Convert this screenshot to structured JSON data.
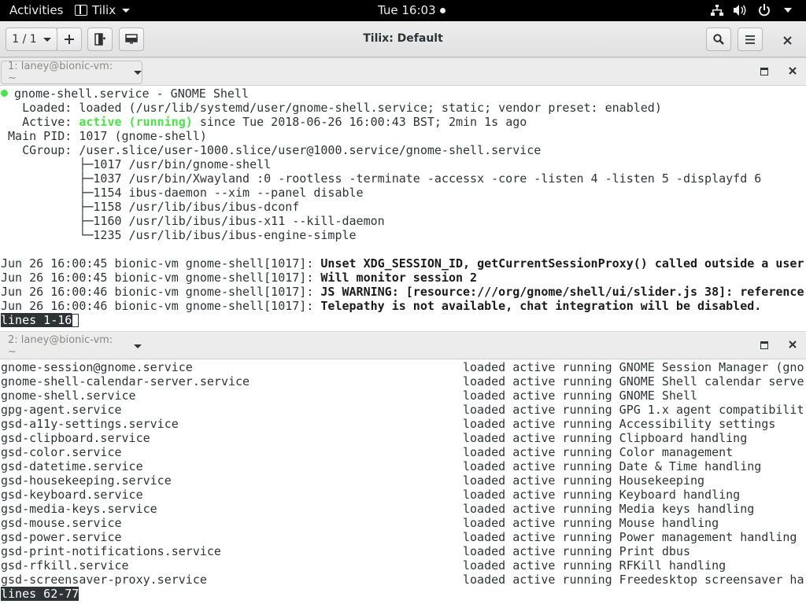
{
  "topbar": {
    "activities": "Activities",
    "app_name": "Tilix",
    "clock": "Tue 16:03",
    "icons": [
      "network-icon",
      "volume-icon",
      "power-icon",
      "chevron-down-icon"
    ]
  },
  "header": {
    "session_label": "1 / 1",
    "title": "Tilix: Default",
    "buttons": [
      "add-icon",
      "split-right-icon",
      "split-down-icon",
      "search-icon",
      "hamburger-menu-icon",
      "close-icon"
    ]
  },
  "pane1": {
    "title": "1: laney@bionic-vm: ~",
    "lines": {
      "l1": "gnome-shell.service - GNOME Shell",
      "l2": "   Loaded: loaded (/usr/lib/systemd/user/gnome-shell.service; static; vendor preset: enabled)",
      "l3a": "   Active: ",
      "l3b": "active (running)",
      "l3c": " since Tue 2018-06-26 16:00:43 BST; 2min 1s ago",
      "l4": " Main PID: 1017 (gnome-shell)",
      "l5": "   CGroup: /user.slice/user-1000.slice/user@1000.service/gnome-shell.service",
      "l6": "           ├─1017 /usr/bin/gnome-shell",
      "l7": "           ├─1037 /usr/bin/Xwayland :0 -rootless -terminate -accessx -core -listen 4 -listen 5 -displayfd 6",
      "l8": "           ├─1154 ibus-daemon --xim --panel disable",
      "l9": "           ├─1158 /usr/lib/ibus/ibus-dconf",
      "l10": "           ├─1160 /usr/lib/ibus/ibus-x11 --kill-daemon",
      "l11": "           └─1235 /usr/lib/ibus/ibus-engine-simple",
      "log": [
        {
          "prefix": "Jun 26 16:00:45 bionic-vm gnome-shell[1017]: ",
          "msg": "Unset XDG_SESSION_ID, getCurrentSessionProxy() called outside a user"
        },
        {
          "prefix": "Jun 26 16:00:45 bionic-vm gnome-shell[1017]: ",
          "msg": "Will monitor session 2"
        },
        {
          "prefix": "Jun 26 16:00:46 bionic-vm gnome-shell[1017]: ",
          "msg": "JS WARNING: [resource:///org/gnome/shell/ui/slider.js 38]: reference"
        },
        {
          "prefix": "Jun 26 16:00:46 bionic-vm gnome-shell[1017]: ",
          "msg": "Telepathy is not available, chat integration will be disabled."
        }
      ],
      "status": "lines 1-16"
    }
  },
  "pane2": {
    "title": "2: laney@bionic-vm: ~",
    "rows": [
      {
        "unit": "gnome-session@gnome.service",
        "state": "loaded active running GNOME Session Manager (gno"
      },
      {
        "unit": "gnome-shell-calendar-server.service",
        "state": "loaded active running GNOME Shell calendar serve"
      },
      {
        "unit": "gnome-shell.service",
        "state": "loaded active running GNOME Shell"
      },
      {
        "unit": "gpg-agent.service",
        "state": "loaded active running GPG 1.x agent compatibilit"
      },
      {
        "unit": "gsd-a11y-settings.service",
        "state": "loaded active running Accessibility settings"
      },
      {
        "unit": "gsd-clipboard.service",
        "state": "loaded active running Clipboard handling"
      },
      {
        "unit": "gsd-color.service",
        "state": "loaded active running Color management"
      },
      {
        "unit": "gsd-datetime.service",
        "state": "loaded active running Date & Time handling"
      },
      {
        "unit": "gsd-housekeeping.service",
        "state": "loaded active running Housekeeping"
      },
      {
        "unit": "gsd-keyboard.service",
        "state": "loaded active running Keyboard handling"
      },
      {
        "unit": "gsd-media-keys.service",
        "state": "loaded active running Media keys handling"
      },
      {
        "unit": "gsd-mouse.service",
        "state": "loaded active running Mouse handling"
      },
      {
        "unit": "gsd-power.service",
        "state": "loaded active running Power management handling"
      },
      {
        "unit": "gsd-print-notifications.service",
        "state": "loaded active running Print dbus"
      },
      {
        "unit": "gsd-rfkill.service",
        "state": "loaded active running RFKill handling"
      },
      {
        "unit": "gsd-screensaver-proxy.service",
        "state": "loaded active running Freedesktop screensaver ha"
      }
    ],
    "status": "lines 62-77"
  },
  "colors": {
    "topbar_bg": "#000000",
    "active_green": "#4ae34a",
    "terminal_bg": "#ffffff",
    "terminal_fg": "#2e3436"
  }
}
